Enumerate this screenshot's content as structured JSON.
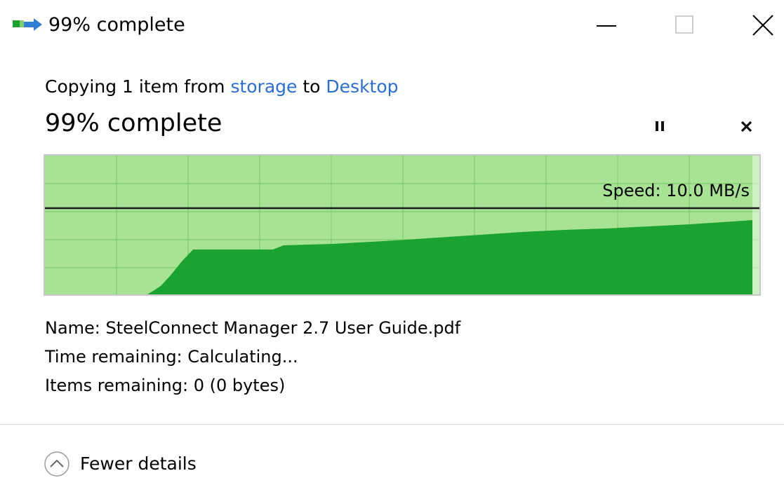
{
  "window": {
    "title": "99% complete",
    "controls": {
      "minimize": "minimize",
      "maximize": "maximize",
      "close": "close"
    }
  },
  "copy": {
    "prefix": "Copying 1 item from ",
    "source": "storage",
    "middle": " to ",
    "destination": "Desktop"
  },
  "status": {
    "percent_text": "99% complete",
    "percent": 99
  },
  "graph": {
    "speed_text": "Speed: 10.0 MB/s",
    "fill_color": "#1aa32e",
    "background_color": "#a8e294",
    "grid_color": "#86cf74"
  },
  "details": {
    "name_label": "Name:",
    "name_value": "SteelConnect Manager 2.7 User Guide.pdf",
    "time_label": "Time remaining:",
    "time_value": "Calculating...",
    "items_label": "Items remaining:",
    "items_value": "0 (0 bytes)"
  },
  "footer": {
    "toggle_label": "Fewer details",
    "toggle_icon": "chevron-up-circle-icon"
  },
  "colors": {
    "link": "#2a6ed4"
  }
}
